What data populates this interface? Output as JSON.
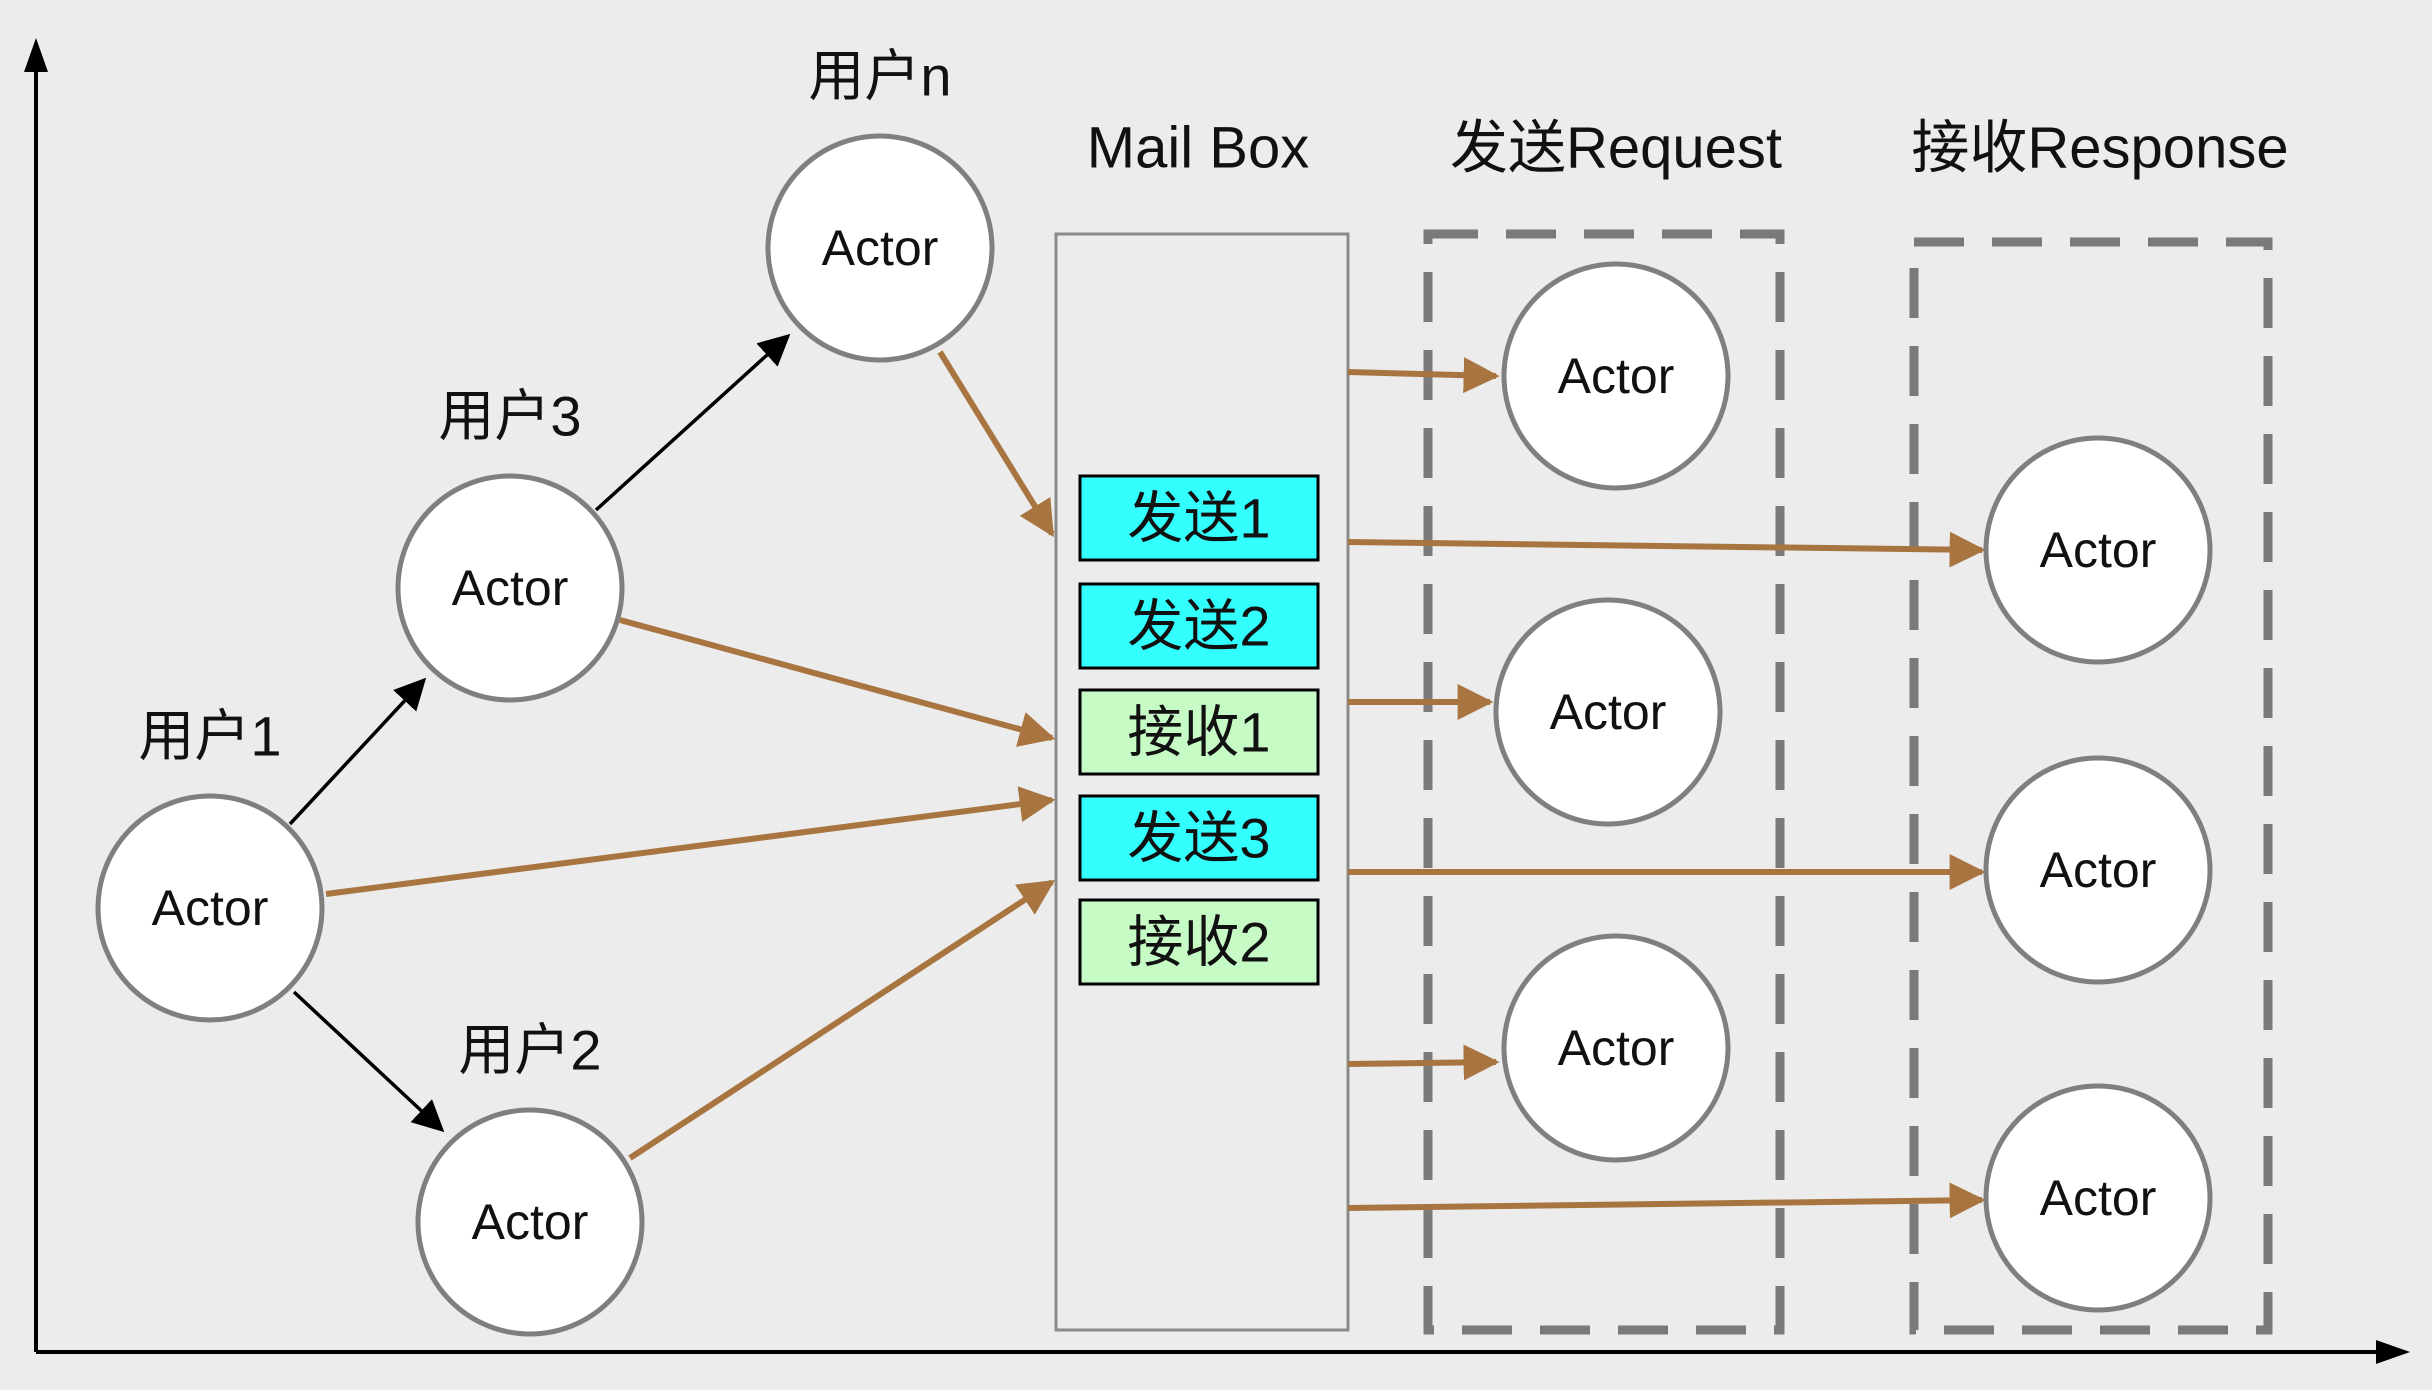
{
  "users": [
    {
      "id": "u1",
      "label": "用户1",
      "actor_label": "Actor"
    },
    {
      "id": "u3",
      "label": "用户3",
      "actor_label": "Actor"
    },
    {
      "id": "un",
      "label": "用户n",
      "actor_label": "Actor"
    },
    {
      "id": "u2",
      "label": "用户2",
      "actor_label": "Actor"
    }
  ],
  "mailbox": {
    "title": "Mail Box",
    "messages": [
      {
        "label": "发送1",
        "kind": "send",
        "color": "#33ffff"
      },
      {
        "label": "发送2",
        "kind": "send",
        "color": "#33ffff"
      },
      {
        "label": "接收1",
        "kind": "receive",
        "color": "#c6fbc6"
      },
      {
        "label": "发送3",
        "kind": "send",
        "color": "#33ffff"
      },
      {
        "label": "接收2",
        "kind": "receive",
        "color": "#c6fbc6"
      }
    ]
  },
  "request_group": {
    "title": "发送Request",
    "actors": [
      "Actor",
      "Actor",
      "Actor"
    ]
  },
  "response_group": {
    "title": "接收Response",
    "actors": [
      "Actor",
      "Actor",
      "Actor"
    ]
  },
  "colors": {
    "background": "#ececec",
    "flow_arrow": "#a87540",
    "user_arrow": "#000000",
    "circle_stroke": "#7f7f7f",
    "dashed_box": "#7a7a7a",
    "send_fill": "#33ffff",
    "receive_fill": "#c6fbc6"
  }
}
